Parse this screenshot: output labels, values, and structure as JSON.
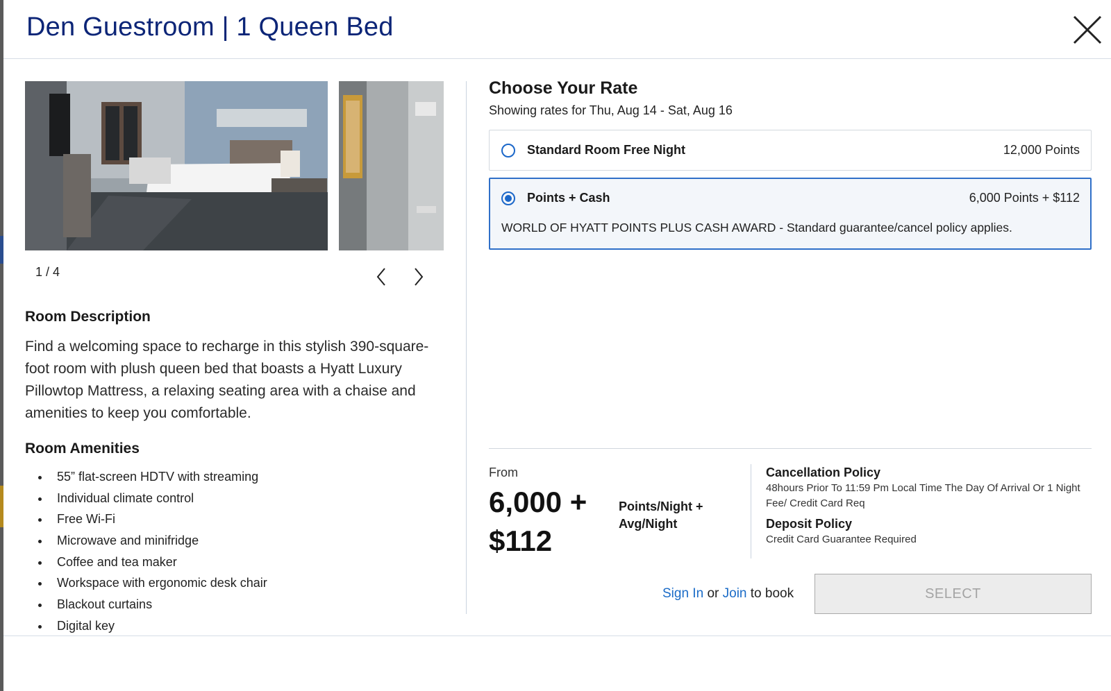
{
  "modal": {
    "title": "Den Guestroom | 1 Queen Bed"
  },
  "gallery": {
    "counter": "1 / 4"
  },
  "room": {
    "description_heading": "Room Description",
    "description": "Find a welcoming space to recharge in this stylish 390-square-foot room with plush queen bed that boasts a Hyatt Luxury Pillowtop Mattress, a relaxing seating area with a chaise and amenities to keep you comfortable.",
    "amenities_heading": "Room Amenities",
    "amenities": [
      "55” flat-screen HDTV with streaming",
      "Individual climate control",
      "Free Wi-Fi",
      "Microwave and minifridge",
      "Coffee and tea maker",
      "Workspace with ergonomic desk chair",
      "Blackout curtains",
      "Digital key"
    ]
  },
  "rates": {
    "heading": "Choose Your Rate",
    "dates": "Showing rates for Thu, Aug 14 - Sat, Aug 16",
    "options": [
      {
        "name": "Standard Room Free Night",
        "price": "12,000 Points",
        "selected": false
      },
      {
        "name": "Points + Cash",
        "price": "6,000 Points + $112",
        "detail": "WORLD OF HYATT POINTS PLUS CASH AWARD - Standard guarantee/cancel policy applies.",
        "selected": true
      }
    ]
  },
  "summary": {
    "from_label": "From",
    "price_line1": "6,000 +",
    "price_line2": "$112",
    "per_night_line1": "Points/Night +",
    "per_night_line2": "Avg/Night",
    "cancellation_heading": "Cancellation Policy",
    "cancellation_text": "48hours Prior To 11:59 Pm Local Time The Day Of Arrival Or 1 Night Fee/ Credit Card Req",
    "deposit_heading": "Deposit Policy",
    "deposit_text": "Credit Card Guarantee Required"
  },
  "booking": {
    "sign_in": "Sign In",
    "or": "or",
    "join": "Join",
    "to_book": "to book",
    "select_label": "SELECT"
  },
  "colors": {
    "title": "#0c2577",
    "accent": "#1b67c9",
    "selected_border": "#2f6fc8",
    "disabled_button": "#ececec"
  }
}
